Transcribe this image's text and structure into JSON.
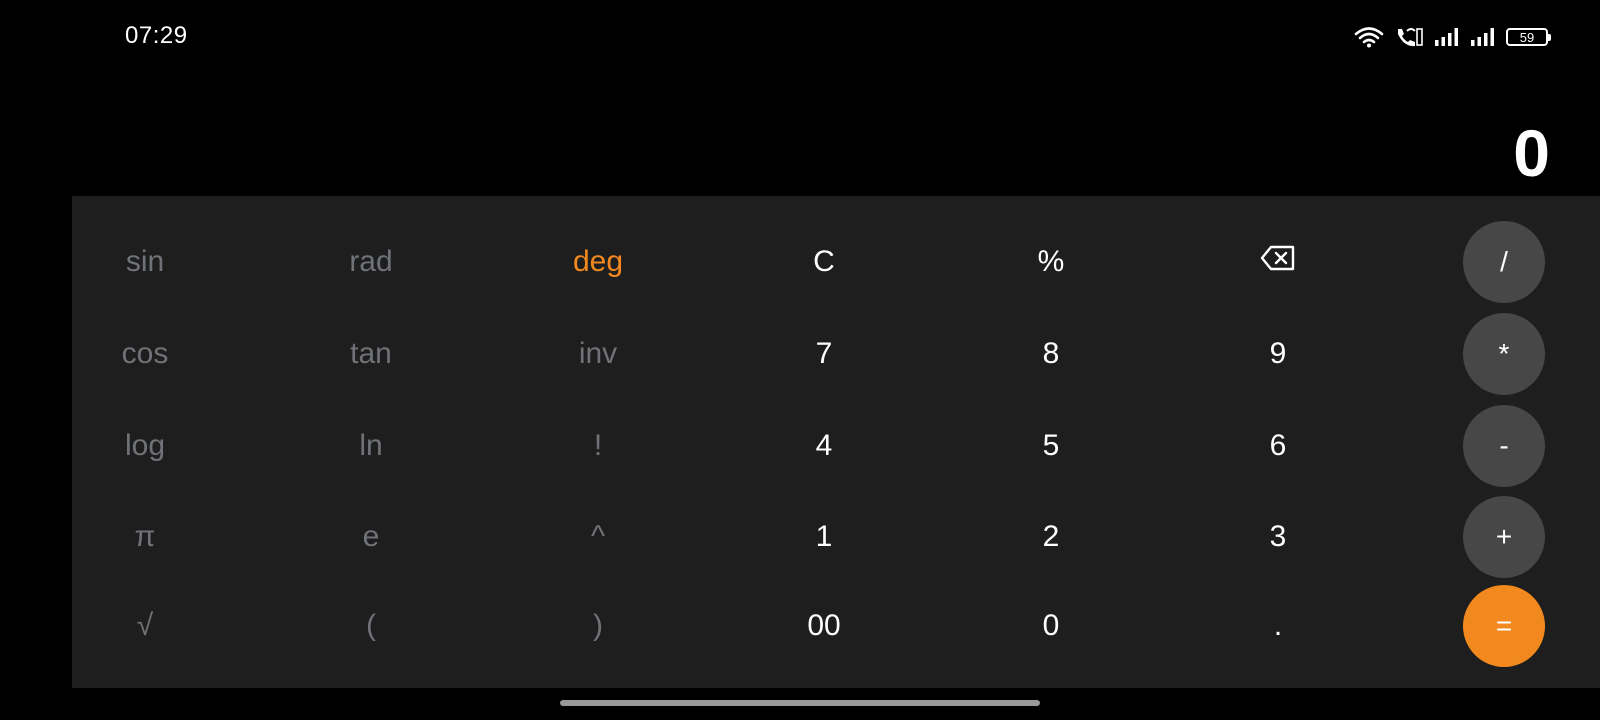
{
  "status_bar": {
    "time": "07:29",
    "battery_level": "59",
    "icons": [
      "wifi-icon",
      "wifi-calling-icon",
      "signal-icon",
      "signal-icon",
      "battery-icon"
    ]
  },
  "display": {
    "value": "0"
  },
  "keypad": {
    "row1": [
      "sin",
      "rad",
      "deg",
      "C",
      "%",
      "backspace",
      "/"
    ],
    "row2": [
      "cos",
      "tan",
      "inv",
      "7",
      "8",
      "9",
      "*"
    ],
    "row3": [
      "log",
      "ln",
      "!",
      "4",
      "5",
      "6",
      "-"
    ],
    "row4": [
      "π",
      "e",
      "^",
      "1",
      "2",
      "3",
      "+"
    ],
    "row5": [
      "√",
      "(",
      ")",
      "00",
      "0",
      ".",
      "="
    ]
  },
  "colors": {
    "accent": "#f2891e",
    "panel": "#1e1e1e",
    "operator_bg": "#474747",
    "scientific_text": "#6f7276"
  }
}
